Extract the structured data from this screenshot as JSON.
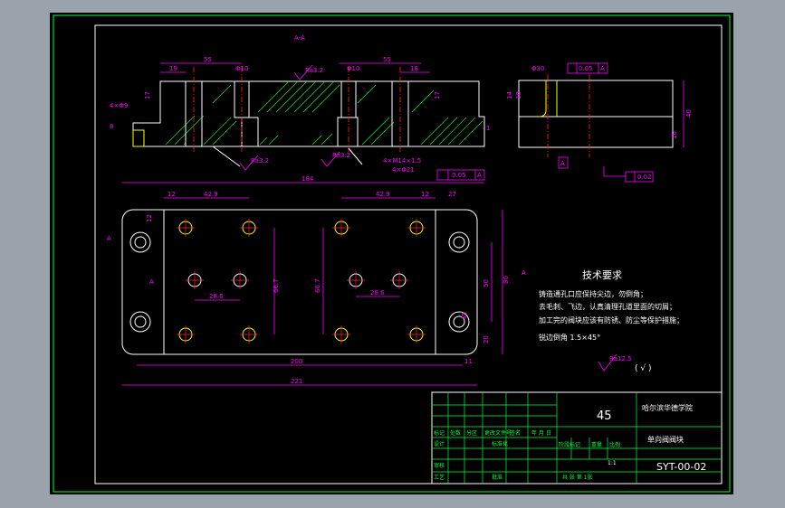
{
  "drawing": {
    "section_label": "A-A",
    "view_markers": [
      "A",
      "A",
      "A"
    ],
    "left_section_dims": [
      "55",
      "19",
      "Φ10",
      "17",
      "4×Φ9",
      "8"
    ],
    "right_section_dims": [
      "55",
      "Φ10",
      "18",
      "17",
      "1"
    ],
    "section_bottom_dims": [
      "4×M14×1.5",
      "4×Φ21"
    ],
    "section_roughness": [
      "Ra3.2",
      "Ra3.2",
      "Ra3.2"
    ],
    "tolerance_frame_flat": "0.05",
    "tolerance_frame_perp": "0.02",
    "tolerance_frame_parallel": "0.05",
    "tolerance_datum": "A",
    "side_view_dims": [
      "Φ30",
      "14",
      "18",
      "40",
      "16"
    ],
    "plan_dims": {
      "total_top": "184",
      "left_42": "42.9",
      "right_42": "42.9",
      "left_12": "12",
      "right_12": "12",
      "right_27": "27",
      "left_28": "28.6",
      "right_28": "28.6",
      "mid_66_left": "66.7",
      "mid_66_right": "66.7",
      "h_50": "50",
      "h_80": "80",
      "h_45": "45",
      "h_20": "20",
      "bottom_200": "200",
      "bottom_221": "221",
      "right_11": "11",
      "left_12_v": "12"
    },
    "tech_title": "技术要求",
    "tech_lines": [
      "铸造通孔口应保持尖边，勿倒角；",
      "去毛刺、飞边，认真清理孔道里面的切屑；",
      "加工完的阀块应该有防锈、防尘等保护措施；",
      "锐边倒角 1.5×45°"
    ],
    "general_roughness": "Ra12.5"
  },
  "title_block": {
    "material": "45",
    "school": "哈尔滨华德学院",
    "part_name": "单向阀阀块",
    "drawing_no": "SYT-00-02",
    "scale": "1:1",
    "row_labels_left": [
      "标记",
      "处数",
      "分区",
      "更改文件号",
      "签名",
      "年 月 日"
    ],
    "design_label": "设计",
    "standard_label": "标准化",
    "stage_label": "阶段标记",
    "weight_label": "重量",
    "scale_label": "比例",
    "review_label": "审核",
    "process_label": "工艺",
    "approve_label": "批准",
    "sheet_text": "共  张  第  1张"
  }
}
